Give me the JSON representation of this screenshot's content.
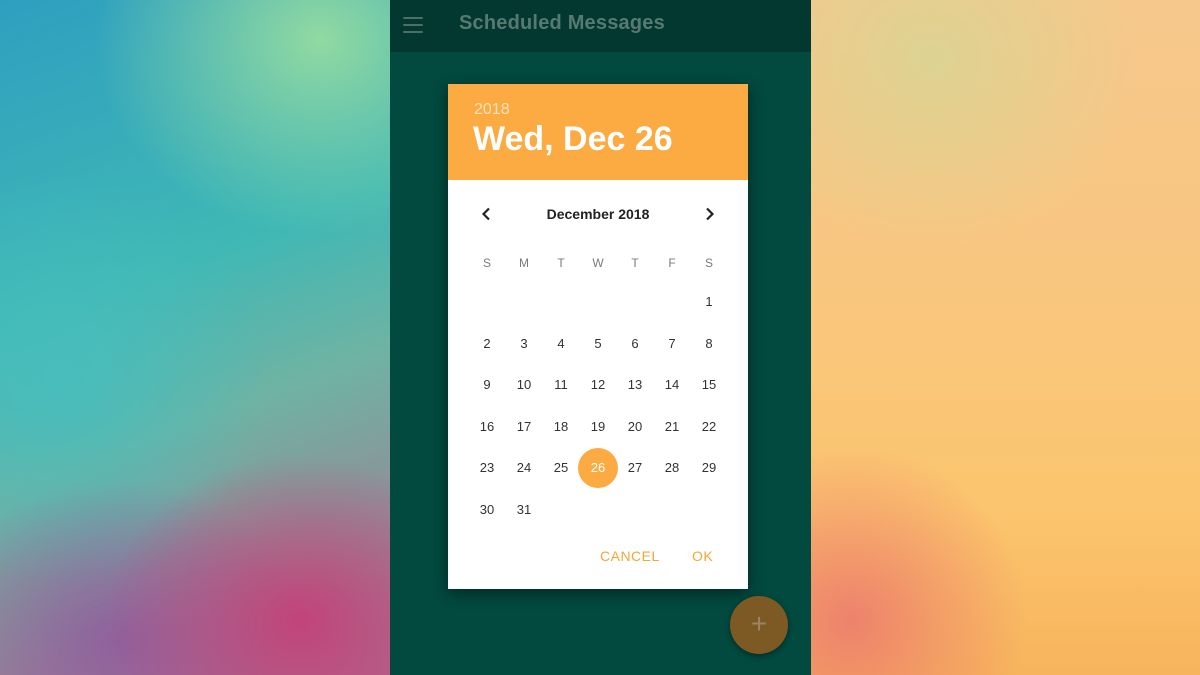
{
  "app_bar": {
    "title": "Scheduled Messages",
    "menu_icon": "hamburger-menu-icon"
  },
  "date_picker": {
    "year": "2018",
    "selected_date_label": "Wed, Dec 26",
    "month_label": "December 2018",
    "prev_icon": "chevron-left-icon",
    "next_icon": "chevron-right-icon",
    "weekdays": [
      "S",
      "M",
      "T",
      "W",
      "T",
      "F",
      "S"
    ],
    "first_weekday_index": 6,
    "days_in_month": 31,
    "selected_day": 26,
    "cancel_label": "CANCEL",
    "ok_label": "OK",
    "accent_color": "#fbab41"
  },
  "fab": {
    "label": "+",
    "icon": "add-icon"
  },
  "colors": {
    "phone_background": "#02493f",
    "app_bar_background": "#023830"
  }
}
